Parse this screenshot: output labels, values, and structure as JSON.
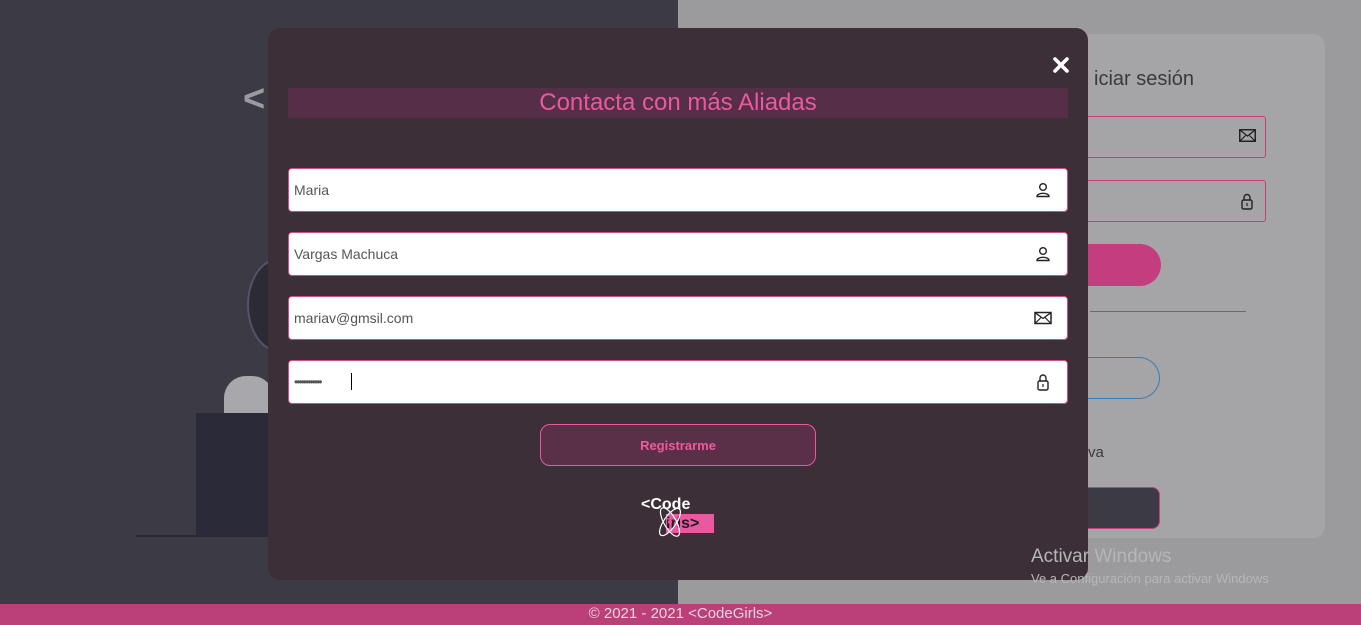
{
  "background": {
    "hero_symbol": "<",
    "login": {
      "title": "Iniciar sesión",
      "partial_text": "va",
      "title_visible": "iciar sesión"
    }
  },
  "modal": {
    "title": "Contacta con más Aliadas",
    "close_icon": "close-icon",
    "fields": [
      {
        "name": "first-name",
        "value": "Maria",
        "icon": "user-icon"
      },
      {
        "name": "last-name",
        "value": "Vargas Machuca",
        "icon": "user-icon"
      },
      {
        "name": "email",
        "value": "mariav@gmsil.com",
        "icon": "mail-icon"
      },
      {
        "name": "password",
        "value": "••••••••••••",
        "icon": "lock-icon"
      }
    ],
    "submit_label": "Registrarme",
    "logo": {
      "line1": "<Code",
      "line2": "irls>"
    }
  },
  "footer": {
    "text": "© 2021 - 2021 <CodeGirls>"
  },
  "os_watermark": {
    "title": "Activar Windows",
    "subtitle": "Ve a Configuración para activar Windows"
  },
  "colors": {
    "accent": "#e9599f",
    "modal_bg": "#3d2f38",
    "title_bar": "#572e47",
    "footer": "#bb3f78"
  }
}
